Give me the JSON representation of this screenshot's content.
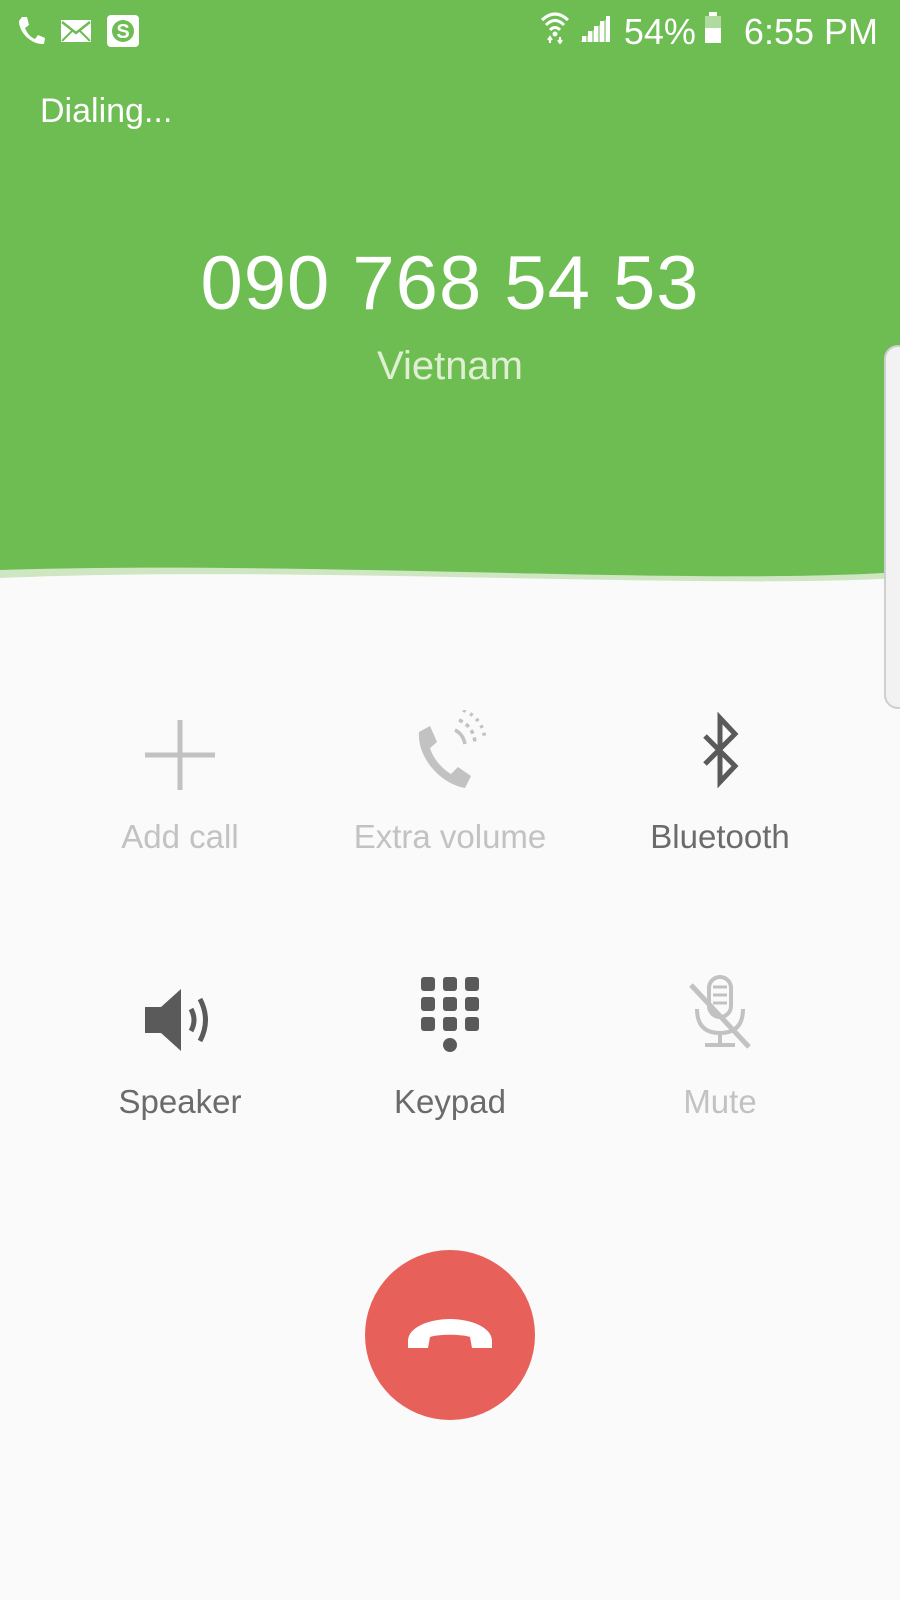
{
  "status_bar": {
    "left_icons": [
      "phone-icon",
      "mail-icon",
      "money-app-icon"
    ],
    "right_icons": [
      "wifi-icon",
      "signal-icon",
      "battery-icon"
    ],
    "battery": "54%",
    "time": "6:55 PM"
  },
  "call": {
    "state": "Dialing...",
    "number": "090 768 54 53",
    "location": "Vietnam"
  },
  "actions": [
    {
      "label": "Add call",
      "icon": "plus-icon",
      "enabled": false
    },
    {
      "label": "Extra volume",
      "icon": "extra-volume-icon",
      "enabled": false
    },
    {
      "label": "Bluetooth",
      "icon": "bluetooth-icon",
      "enabled": true
    },
    {
      "label": "Speaker",
      "icon": "speaker-icon",
      "enabled": true
    },
    {
      "label": "Keypad",
      "icon": "keypad-icon",
      "enabled": true
    },
    {
      "label": "Mute",
      "icon": "mic-off-icon",
      "enabled": false
    }
  ],
  "end_call": {
    "icon": "end-call-icon"
  },
  "colors": {
    "header_green": "#6dbd52",
    "end_call_red": "#e8605a",
    "enabled_icon": "#5a5a5a",
    "disabled_icon": "#c2c2c2"
  }
}
